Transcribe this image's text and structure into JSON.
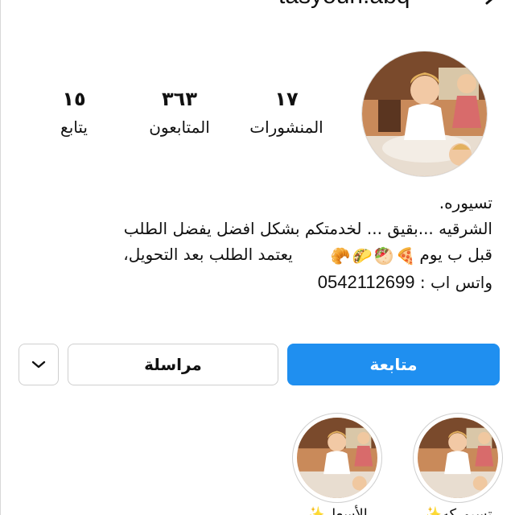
{
  "header": {
    "username": "tasyouri.abq"
  },
  "profile": {
    "avatar_icon": "profile-photo-girl-kitchen"
  },
  "stats": {
    "posts": {
      "value": "١٧",
      "label": "المنشورات"
    },
    "followers": {
      "value": "٣٦٣",
      "label": "المتابعون"
    },
    "following": {
      "value": "١٥",
      "label": "يتابع"
    }
  },
  "bio": {
    "name": "تسيوره.",
    "line1": "الشرقيه ...بقيق ... لخدمتكم  بشكل افضل  يفضل الطلب",
    "line2_start": "قبل ب يوم",
    "line2_end": "يعتمد الطلب بعد التحويل،",
    "emojis": [
      "🥐",
      "🌮",
      "🥙",
      "🍕"
    ],
    "whatsapp_label": "واتس اب :",
    "whatsapp_number": "0542112699"
  },
  "actions": {
    "follow_label": "متابعة",
    "message_label": "مراسلة",
    "more_icon": "chevron-down-icon"
  },
  "highlights": [
    {
      "label": "تسيوركه✨"
    },
    {
      "label": "الأسعار✨"
    }
  ],
  "colors": {
    "follow_button": "#1f8ff0",
    "border": "#cfcfcf"
  }
}
